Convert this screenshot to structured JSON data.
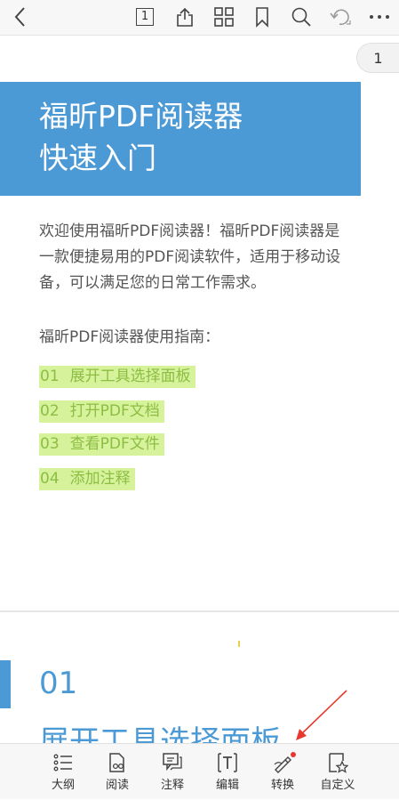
{
  "toolbar": {
    "page_number": "1"
  },
  "page_counter": "1",
  "document": {
    "title_line1": "福昕PDF阅读器",
    "title_line2": "快速入门",
    "intro_line1": "欢迎使用福昕PDF阅读器！福昕PDF阅读器是",
    "intro_line2": "一款便捷易用的PDF阅读软件，适用于移动设",
    "intro_line3": "备，可以满足您的日常工作需求。",
    "guide_heading": "福昕PDF阅读器使用指南：",
    "toc": [
      {
        "num": "01",
        "text": "展开工具选择面板"
      },
      {
        "num": "02",
        "text": "打开PDF文档"
      },
      {
        "num": "03",
        "text": "查看PDF文件"
      },
      {
        "num": "04",
        "text": "添加注释"
      }
    ],
    "section_number": "01",
    "section_title": "展开工具选择面板"
  },
  "bottom_bar": [
    {
      "icon": "outline-icon",
      "label": "大纲"
    },
    {
      "icon": "read-icon",
      "label": "阅读"
    },
    {
      "icon": "comment-icon",
      "label": "注释"
    },
    {
      "icon": "edit-icon",
      "label": "编辑"
    },
    {
      "icon": "convert-icon",
      "label": "转换"
    },
    {
      "icon": "customize-icon",
      "label": "自定义"
    }
  ],
  "colors": {
    "accent": "#4b9ad6",
    "highlight": "#d6f29a",
    "highlight_text": "#8dbd45",
    "notification": "#e8382d"
  }
}
